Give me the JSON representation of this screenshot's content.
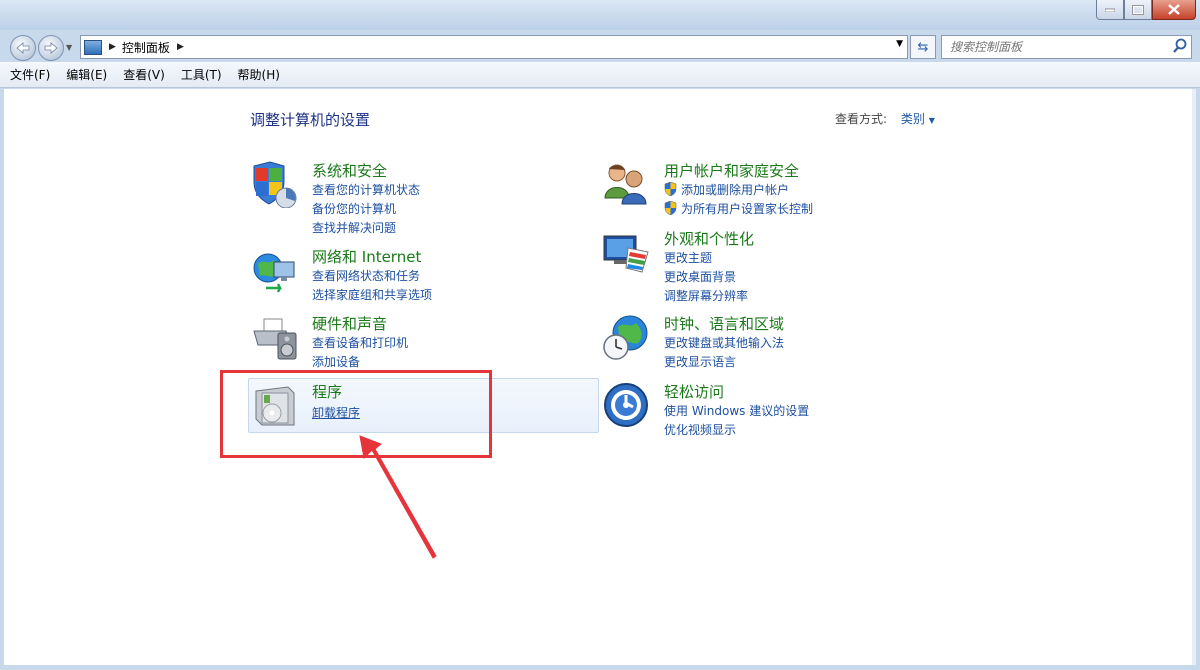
{
  "window": {
    "title": ""
  },
  "navigation": {
    "breadcrumb": "控制面板",
    "search_placeholder": "搜索控制面板"
  },
  "menu": {
    "items": [
      "文件(F)",
      "编辑(E)",
      "查看(V)",
      "工具(T)",
      "帮助(H)"
    ]
  },
  "main": {
    "page_title": "调整计算机的设置",
    "view_by_label": "查看方式:",
    "view_by_value": "类别"
  },
  "categories": {
    "system": {
      "title": "系统和安全",
      "links": [
        "查看您的计算机状态",
        "备份您的计算机",
        "查找并解决问题"
      ]
    },
    "network": {
      "title": "网络和 Internet",
      "links": [
        "查看网络状态和任务",
        "选择家庭组和共享选项"
      ]
    },
    "hardware": {
      "title": "硬件和声音",
      "links": [
        "查看设备和打印机",
        "添加设备"
      ]
    },
    "programs": {
      "title": "程序",
      "links": [
        "卸载程序"
      ]
    },
    "users": {
      "title": "用户帐户和家庭安全",
      "links": [
        "添加或删除用户帐户",
        "为所有用户设置家长控制"
      ]
    },
    "appearance": {
      "title": "外观和个性化",
      "links": [
        "更改主题",
        "更改桌面背景",
        "调整屏幕分辨率"
      ]
    },
    "clock": {
      "title": "时钟、语言和区域",
      "links": [
        "更改键盘或其他输入法",
        "更改显示语言"
      ]
    },
    "ease": {
      "title": "轻松访问",
      "links": [
        "使用 Windows 建议的设置",
        "优化视频显示"
      ]
    }
  },
  "colors": {
    "annotation": "#e5353b",
    "link": "#1e50a0",
    "category_title": "#1a7a1a"
  }
}
